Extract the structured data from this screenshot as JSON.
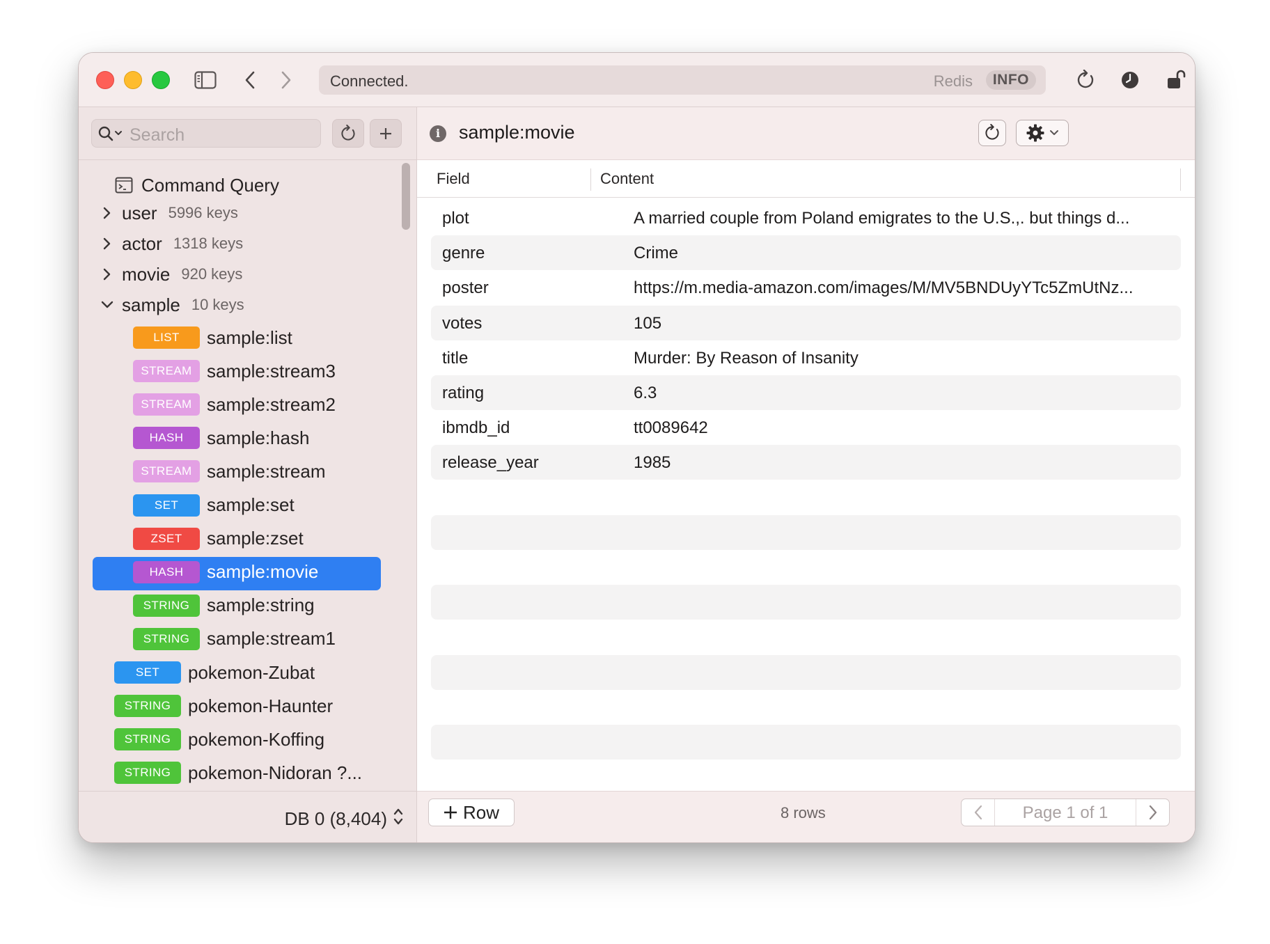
{
  "titlebar": {
    "status": "Connected.",
    "server_type": "Redis",
    "info_label": "INFO"
  },
  "sidebar": {
    "search_placeholder": "Search",
    "command_query": "Command Query",
    "groups": [
      {
        "label": "user",
        "count": "5996 keys"
      },
      {
        "label": "actor",
        "count": "1318 keys"
      },
      {
        "label": "movie",
        "count": "920 keys"
      },
      {
        "label": "sample",
        "count": "10 keys"
      }
    ],
    "sample_keys": [
      {
        "type": "LIST",
        "name": "sample:list",
        "color": "#f89a1c"
      },
      {
        "type": "STREAM",
        "name": "sample:stream3",
        "color": "#e3a0e4"
      },
      {
        "type": "STREAM",
        "name": "sample:stream2",
        "color": "#e3a0e4"
      },
      {
        "type": "HASH",
        "name": "sample:hash",
        "color": "#b557d1"
      },
      {
        "type": "STREAM",
        "name": "sample:stream",
        "color": "#e3a0e4"
      },
      {
        "type": "SET",
        "name": "sample:set",
        "color": "#2b95f0"
      },
      {
        "type": "ZSET",
        "name": "sample:zset",
        "color": "#f04a44"
      },
      {
        "type": "HASH",
        "name": "sample:movie",
        "color": "#b557d1"
      },
      {
        "type": "STRING",
        "name": "sample:string",
        "color": "#4fc43a"
      },
      {
        "type": "STRING",
        "name": "sample:stream1",
        "color": "#4fc43a"
      }
    ],
    "root_keys": [
      {
        "type": "SET",
        "name": "pokemon-Zubat",
        "color": "#2b95f0"
      },
      {
        "type": "STRING",
        "name": "pokemon-Haunter",
        "color": "#4fc43a"
      },
      {
        "type": "STRING",
        "name": "pokemon-Koffing",
        "color": "#4fc43a"
      },
      {
        "type": "STRING",
        "name": "pokemon-Nidoran ?...",
        "color": "#4fc43a"
      }
    ],
    "db_label": "DB 0 (8,404)",
    "selected_color": "#2f7ff2"
  },
  "main": {
    "key_title": "sample:movie",
    "columns": [
      "Field",
      "Content"
    ],
    "rows": [
      {
        "field": "plot",
        "content": "A married couple from Poland emigrates to the U.S.,. but things d..."
      },
      {
        "field": "genre",
        "content": "Crime"
      },
      {
        "field": "poster",
        "content": "https://m.media-amazon.com/images/M/MV5BNDUyYTc5ZmUtNz..."
      },
      {
        "field": "votes",
        "content": "105"
      },
      {
        "field": "title",
        "content": "Murder: By Reason of Insanity"
      },
      {
        "field": "rating",
        "content": "6.3"
      },
      {
        "field": "ibmdb_id",
        "content": "tt0089642"
      },
      {
        "field": "release_year",
        "content": "1985"
      }
    ],
    "add_row_label": "Row",
    "row_count": "8 rows",
    "pager_text": "Page 1 of 1"
  }
}
